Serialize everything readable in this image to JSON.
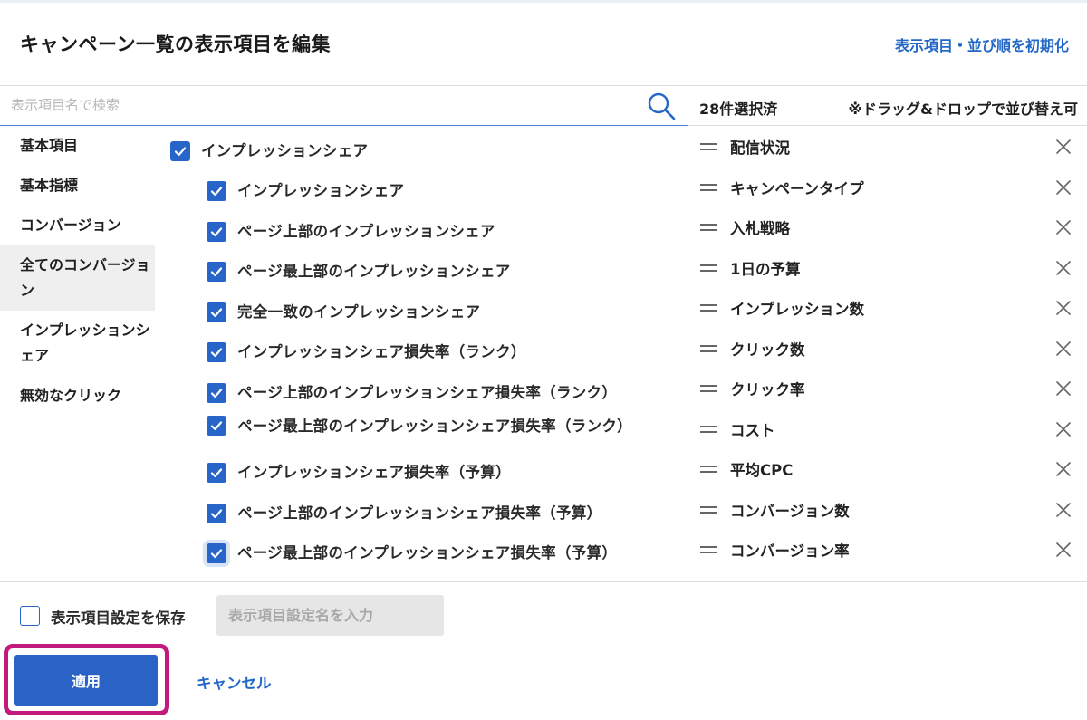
{
  "dialog": {
    "title": "キャンペーン一覧の表示項目を編集",
    "reset_link": "表示項目・並び順を初期化"
  },
  "search": {
    "placeholder": "表示項目名で検索",
    "icon": "search-icon"
  },
  "categories": [
    {
      "label": "基本項目",
      "active": false
    },
    {
      "label": "基本指標",
      "active": false
    },
    {
      "label": "コンバージョン",
      "active": false
    },
    {
      "label": "全てのコンバージョン",
      "active": true
    },
    {
      "label": "インプレッションシェア",
      "active": false
    },
    {
      "label": "無効なクリック",
      "active": false
    }
  ],
  "items": {
    "group": {
      "label": "インプレッションシェア",
      "checked": true
    },
    "children": [
      {
        "label": "インプレッションシェア",
        "checked": true
      },
      {
        "label": "ページ上部のインプレッションシェア",
        "checked": true
      },
      {
        "label": "ページ最上部のインプレッションシェア",
        "checked": true
      },
      {
        "label": "完全一致のインプレッションシェア",
        "checked": true
      },
      {
        "label": "インプレッションシェア損失率（ランク）",
        "checked": true
      },
      {
        "label": "ページ上部のインプレッションシェア損失率（ランク）",
        "checked": true
      },
      {
        "label": "ページ最上部のインプレッションシェア損失率（ランク）",
        "checked": true
      },
      {
        "label": "インプレッションシェア損失率（予算）",
        "checked": true
      },
      {
        "label": "ページ上部のインプレッションシェア損失率（予算）",
        "checked": true
      },
      {
        "label": "ページ最上部のインプレッションシェア損失率（予算）",
        "checked": true
      }
    ]
  },
  "selected": {
    "count_label": "28件選択済",
    "hint": "※ドラッグ&ドロップで並び替え可",
    "items": [
      "配信状況",
      "キャンペーンタイプ",
      "入札戦略",
      "1日の予算",
      "インプレッション数",
      "クリック数",
      "クリック率",
      "コスト",
      "平均CPC",
      "コンバージョン数",
      "コンバージョン率"
    ]
  },
  "footer": {
    "save_label": "表示項目設定を保存",
    "save_checked": false,
    "name_placeholder": "表示項目設定名を入力",
    "apply_label": "適用",
    "cancel_label": "キャンセル"
  },
  "colors": {
    "accent": "#2865c8",
    "link": "#2468c7",
    "highlight": "#c2197d"
  }
}
